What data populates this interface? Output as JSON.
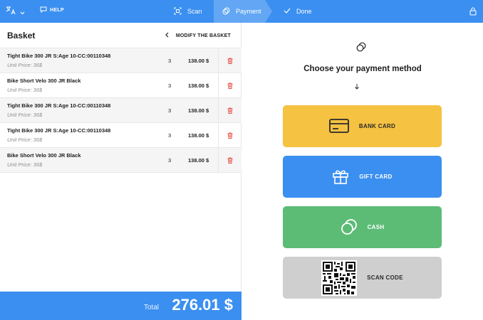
{
  "topbar": {
    "help_label": "HELP",
    "steps": [
      {
        "label": "Scan"
      },
      {
        "label": "Payment"
      },
      {
        "label": "Done"
      }
    ]
  },
  "basket": {
    "title": "Basket",
    "modify_label": "MODIFY THE BASKET",
    "items": [
      {
        "name": "Tight Bike 300 JR S:Age 10-CC:00110348",
        "unit": "Unit Price: 36$",
        "qty": "3",
        "price": "138.00 $"
      },
      {
        "name": "Bike Short Velo 300 JR Black",
        "unit": "Unit Price: 36$",
        "qty": "3",
        "price": "138.00 $"
      },
      {
        "name": "Tight Bike 300 JR S:Age 10-CC:00110348",
        "unit": "Unit Price: 36$",
        "qty": "3",
        "price": "138.00 $"
      },
      {
        "name": "Tight Bike 300 JR S:Age 10-CC:00110348",
        "unit": "Unit Price: 36$",
        "qty": "3",
        "price": "138.00 $"
      },
      {
        "name": "Bike Short Velo 300 JR Black",
        "unit": "Unit Price: 36$",
        "qty": "3",
        "price": "138.00 $"
      }
    ],
    "total_label": "Total",
    "total_value": "276.01 $"
  },
  "payment": {
    "title": "Choose your payment method",
    "methods": [
      {
        "label": "BANK CARD"
      },
      {
        "label": "GIFT CARD"
      },
      {
        "label": "CASH"
      },
      {
        "label": "SCAN CODE"
      }
    ]
  },
  "colors": {
    "primary": "#3b8ff0",
    "bank_card": "#f5c241",
    "gift_card": "#3b8ff0",
    "cash": "#5cbc76",
    "scan_code": "#cfcfcf",
    "delete": "#e5483f"
  }
}
